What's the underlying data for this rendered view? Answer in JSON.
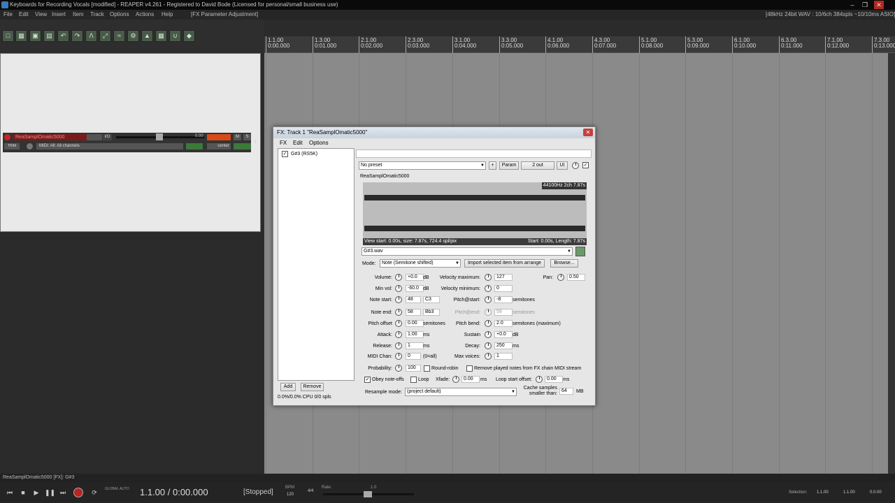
{
  "app": {
    "title": "Keyboards for Recording Vocals [modified] - REAPER v4.261 - Registered to David Bode (Licensed for personal/small business use)",
    "status_right": "[48kHz 24bit WAV : 10/6ch 384spls ~10/10ms ASIO]"
  },
  "menu": {
    "items": [
      "File",
      "Edit",
      "View",
      "Insert",
      "Item",
      "Track",
      "Options",
      "Actions",
      "Help"
    ],
    "context": "[FX Parameter Adjustment]"
  },
  "ruler": {
    "marks": [
      {
        "bar": "1.1.00",
        "time": "0:00.000"
      },
      {
        "bar": "1.3.00",
        "time": "0:01.000"
      },
      {
        "bar": "2.1.00",
        "time": "0:02.000"
      },
      {
        "bar": "2.3.00",
        "time": "0:03.000"
      },
      {
        "bar": "3.1.00",
        "time": "0:04.000"
      },
      {
        "bar": "3.3.00",
        "time": "0:05.000"
      },
      {
        "bar": "4.1.00",
        "time": "0:06.000"
      },
      {
        "bar": "4.3.00",
        "time": "0:07.000"
      },
      {
        "bar": "5.1.00",
        "time": "0:08.000"
      },
      {
        "bar": "5.3.00",
        "time": "0:09.000"
      },
      {
        "bar": "6.1.00",
        "time": "0:10.000"
      },
      {
        "bar": "6.3.00",
        "time": "0:11.000"
      },
      {
        "bar": "7.1.00",
        "time": "0:12.000"
      },
      {
        "bar": "7.3.00",
        "time": "0:13.000"
      }
    ]
  },
  "track": {
    "name": "ReaSamplOmatic5000",
    "fx_label": "I/O",
    "volume": "0.00",
    "midi_input": "MIDI: All: All channels",
    "pan": "center",
    "m": "M",
    "s": "S",
    "trim": "TRIM",
    "num": "1"
  },
  "status": {
    "left": "ReaSamplOmatic5000 [FX]: G#3"
  },
  "transport": {
    "position": "1.1.00 / 0:00.000",
    "state": "[Stopped]",
    "bpm_label": "BPM",
    "bpm": "120",
    "timesig": "4/4",
    "rate_label": "Rate:",
    "rate": "1.0",
    "global_auto": "GLOBAL AUTO",
    "selection_label": "Selection:",
    "sel_start": "1.1.00",
    "sel_end": "1.1.00",
    "sel_len": "0.0.00"
  },
  "fx": {
    "title": "FX: Track 1 \"ReaSamplOmatic5000\"",
    "menu": [
      "FX",
      "Edit",
      "Options"
    ],
    "list_item": "G#3 (RS5K)",
    "add": "Add",
    "remove": "Remove",
    "cpu": "0.0%/0.0% CPU 0/0 spls",
    "preset": "No preset",
    "plus": "+",
    "param": "Param",
    "out": "2 out",
    "ui": "UI",
    "plugin_name": "ReaSamplOmatic5000",
    "wave_info": "44100Hz 2ch 7.87s",
    "view_info": "View start: 0.00s, size: 7.87s, 724.4 spl/pix",
    "start_info": "Start: 0.00s, Length: 7.87s",
    "file": "G#3.wav",
    "mode_label": "Mode:",
    "mode": "Note (Semitone shifted)",
    "import": "Import selected item from arrange",
    "browse": "Browse...",
    "volume": {
      "label": "Volume:",
      "value": "+0.0",
      "unit": "dB"
    },
    "minvol": {
      "label": "Min vol:",
      "value": "-60.0",
      "unit": "dB"
    },
    "notestart": {
      "label": "Note start:",
      "value": "48",
      "note": "C3"
    },
    "noteend": {
      "label": "Note end:",
      "value": "58",
      "note": "Bb3"
    },
    "pitchoffset": {
      "label": "Pitch offset",
      "value": "0.00",
      "unit": "semitones"
    },
    "attack": {
      "label": "Attack:",
      "value": "1.00",
      "unit": "ms"
    },
    "release": {
      "label": "Release:",
      "value": "1",
      "unit": "ms"
    },
    "midichan": {
      "label": "MIDI Chan:",
      "value": "0",
      "unit": "(0=all)"
    },
    "probability": {
      "label": "Probability:",
      "value": "100"
    },
    "velmax": {
      "label": "Velocity maximum:",
      "value": "127"
    },
    "velmin": {
      "label": "Velocity minimum:",
      "value": "0"
    },
    "pitchstart": {
      "label": "Pitch@start:",
      "value": "-8",
      "unit": "semitones"
    },
    "pitchend": {
      "label": "Pitch@end:",
      "value": "59",
      "unit": "semitones"
    },
    "pitchbend": {
      "label": "Pitch bend:",
      "value": "2.0",
      "unit": "semitones (maximum)"
    },
    "sustain": {
      "label": "Sustain",
      "value": "+0.0",
      "unit": "dB"
    },
    "decay": {
      "label": "Decay:",
      "value": "250",
      "unit": "ms"
    },
    "maxvoices": {
      "label": "Max voices:",
      "value": "1"
    },
    "pan": {
      "label": "Pan:",
      "value": "0.50"
    },
    "roundrobin": "Round-robin",
    "removeplayed": "Remove played notes from FX chain MIDI stream",
    "obey": "Obey note-offs",
    "loop": "Loop",
    "xfade": {
      "label": "Xfade:",
      "value": "0.00",
      "unit": "ms"
    },
    "loopstart": {
      "label": "Loop start offset:",
      "value": "0.00",
      "unit": "ms"
    },
    "resample": {
      "label": "Resample mode:",
      "value": "(project default)"
    },
    "cache": {
      "label1": "Cache samples",
      "label2": "smaller than:",
      "value": "64",
      "unit": "MB"
    }
  }
}
